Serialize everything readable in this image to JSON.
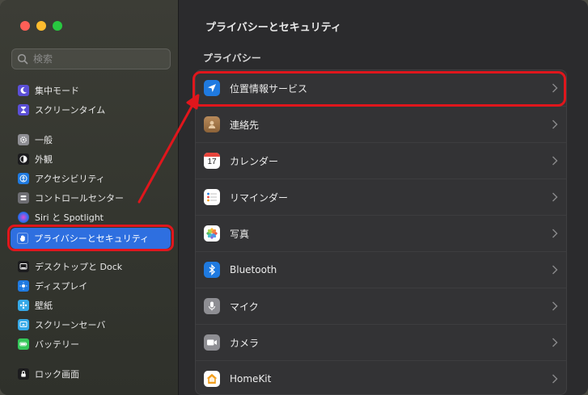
{
  "window": {
    "main_title": "プライバシーとセキュリティ",
    "section_title": "プライバシー"
  },
  "search": {
    "placeholder": "検索"
  },
  "sidebar": {
    "items": [
      {
        "label": "集中モード",
        "icon": "moon-icon",
        "color": "#5b4fd6"
      },
      {
        "label": "スクリーンタイム",
        "icon": "hourglass-icon",
        "color": "#5b4fd6"
      },
      {
        "label": "一般",
        "icon": "gear-icon",
        "color": "#8e8e93"
      },
      {
        "label": "外観",
        "icon": "appearance-icon",
        "color": "#1c1c1e"
      },
      {
        "label": "アクセシビリティ",
        "icon": "accessibility-icon",
        "color": "#1f7ae0"
      },
      {
        "label": "コントロールセンター",
        "icon": "control-center-icon",
        "color": "#6e6e73"
      },
      {
        "label": "Siri と Spotlight",
        "icon": "siri-icon",
        "color": "#222"
      },
      {
        "label": "プライバシーとセキュリティ",
        "icon": "hand-icon",
        "color": "#2e6fe0"
      },
      {
        "label": "デスクトップと Dock",
        "icon": "dock-icon",
        "color": "#1c1c1e"
      },
      {
        "label": "ディスプレイ",
        "icon": "sun-icon",
        "color": "#1f7ae0"
      },
      {
        "label": "壁紙",
        "icon": "wallpaper-icon",
        "color": "#35a9e8"
      },
      {
        "label": "スクリーンセーバ",
        "icon": "screensaver-icon",
        "color": "#35a9e8"
      },
      {
        "label": "バッテリー",
        "icon": "battery-icon",
        "color": "#34c759"
      },
      {
        "label": "ロック画面",
        "icon": "lock-icon",
        "color": "#1c1c1e"
      }
    ]
  },
  "privacy_list": [
    {
      "label": "位置情報サービス",
      "icon": "location-arrow-icon",
      "color": "#1f7ae0"
    },
    {
      "label": "連絡先",
      "icon": "contacts-icon",
      "color": "#a77a4e"
    },
    {
      "label": "カレンダー",
      "icon": "calendar-icon",
      "color": "#ffffff",
      "day": "17"
    },
    {
      "label": "リマインダー",
      "icon": "reminders-icon",
      "color": "#ffffff"
    },
    {
      "label": "写真",
      "icon": "photos-icon",
      "color": "#ffffff"
    },
    {
      "label": "Bluetooth",
      "icon": "bluetooth-icon",
      "color": "#1f7ae0"
    },
    {
      "label": "マイク",
      "icon": "microphone-icon",
      "color": "#8e8e93"
    },
    {
      "label": "カメラ",
      "icon": "camera-icon",
      "color": "#8e8e93"
    },
    {
      "label": "HomeKit",
      "icon": "home-icon",
      "color": "#ffffff"
    }
  ],
  "annotation_color": "#e0161c"
}
